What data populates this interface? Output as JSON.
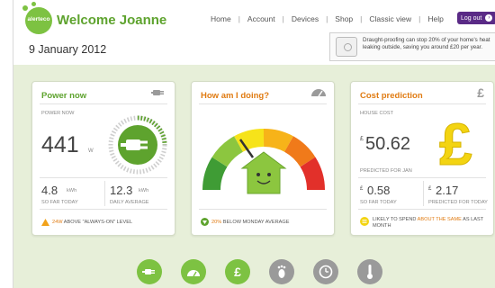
{
  "header": {
    "logo_text": "alerteco",
    "welcome": "Welcome Joanne",
    "date": "9 January 2012"
  },
  "nav": {
    "home": "Home",
    "account": "Account",
    "devices": "Devices",
    "shop": "Shop",
    "classic": "Classic view",
    "help": "Help",
    "logout": "Log out"
  },
  "tip": {
    "text": "Draught-proofing can stop 20% of your home's heat leaking outside, saving you around £20 per year."
  },
  "power_now": {
    "title": "Power now",
    "label": "POWER NOW",
    "value": "441",
    "unit": "W",
    "today_value": "4.8",
    "today_unit": "kWh",
    "today_label": "SO FAR TODAY",
    "avg_value": "12.3",
    "avg_unit": "kWh",
    "avg_label": "DAILY AVERAGE",
    "note_highlight": "24W",
    "note_rest": "ABOVE \"ALWAYS-ON\" LEVEL"
  },
  "how_am_i": {
    "title": "How am I doing?",
    "note_highlight": "20%",
    "note_rest": "BELOW MONDAY AVERAGE"
  },
  "cost": {
    "title": "Cost prediction",
    "label": "HOUSE COST",
    "currency": "£",
    "value": "50.62",
    "predicted_label": "PREDICTED FOR JAN",
    "so_far_currency": "£",
    "so_far_value": "0.58",
    "so_far_label": "SO FAR TODAY",
    "predicted_today_currency": "£",
    "predicted_today_value": "2.17",
    "predicted_today_label": "PREDICTED FOR TODAY",
    "note_pre": "LIKELY TO SPEND",
    "note_highlight": "ABOUT THE SAME",
    "note_post": "AS LAST MONTH"
  },
  "colors": {
    "brand_green": "#7dc242",
    "orange": "#e07b12",
    "logout_purple": "#5a2a86",
    "panel_bg": "#e7efd9"
  },
  "icons": {
    "card1": "plug-icon",
    "card2": "gauge-icon",
    "card3": "pound-icon",
    "bottom_nav": [
      "plug-icon",
      "gauge-icon",
      "pound-icon",
      "footprint-icon",
      "clock-icon",
      "thermometer-icon"
    ]
  }
}
